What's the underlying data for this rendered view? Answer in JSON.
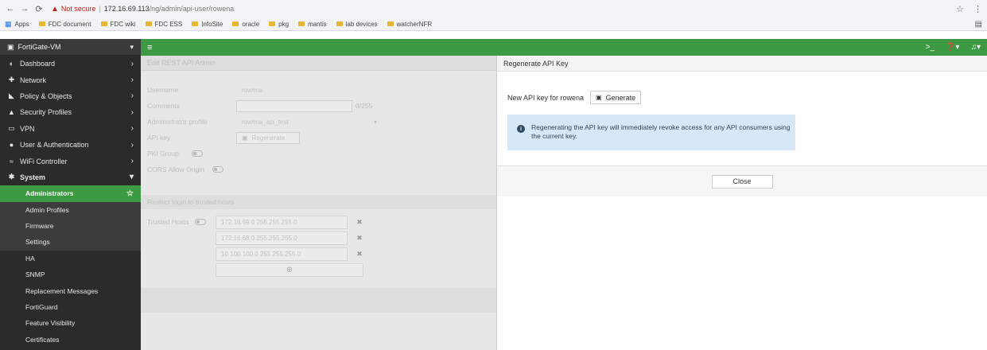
{
  "browser": {
    "security": "Not secure",
    "url_host": "172.16.69.113",
    "url_path": "/ng/admin/api-user/rowena"
  },
  "bookmarks": [
    "Apps",
    "FDC document",
    "FDC wiki",
    "FDC ESS",
    "InfoSite",
    "oracle",
    "pkg",
    "mantis",
    "lab devices",
    "watcherNFR"
  ],
  "sidebar": {
    "device": "FortiGate-VM",
    "items": [
      {
        "label": "Dashboard",
        "icon": "◐"
      },
      {
        "label": "Network",
        "icon": "✚"
      },
      {
        "label": "Policy & Objects",
        "icon": "◣"
      },
      {
        "label": "Security Profiles",
        "icon": "▲"
      },
      {
        "label": "VPN",
        "icon": "▭"
      },
      {
        "label": "User & Authentication",
        "icon": "●"
      },
      {
        "label": "WiFi Controller",
        "icon": "≈"
      }
    ],
    "system_label": "System",
    "sub_items": [
      "Administrators",
      "Admin Profiles",
      "Firmware",
      "Settings",
      "HA",
      "SNMP",
      "Replacement Messages",
      "FortiGuard",
      "Feature Visibility",
      "Certificates"
    ]
  },
  "left_panel": {
    "title": "Edit REST API Admin",
    "username_label": "Username",
    "username_value": "rowena",
    "comments_label": "Comments",
    "comments_counter": "0/255",
    "profile_label": "Administrator profile",
    "profile_value": "rowena_api_test",
    "apikey_label": "API key",
    "regenerate_label": "Regenerate",
    "pki_label": "PKI Group",
    "cors_label": "CORS Allow Origin",
    "restrict_label": "Restrict login to trusted hosts",
    "trusted_label": "Trusted Hosts",
    "hosts": [
      "172.16.69.0 255.255.255.0",
      "172.16.68.0 255.255.255.0",
      "10.100.100.0 255.255.255.0"
    ]
  },
  "dialog": {
    "title": "Regenerate API Key",
    "key_label": "New API key for rowena",
    "generate_label": "Generate",
    "info_text": "Regenerating the API key will immediately revoke access for any API consumers using the current key.",
    "close_label": "Close"
  }
}
